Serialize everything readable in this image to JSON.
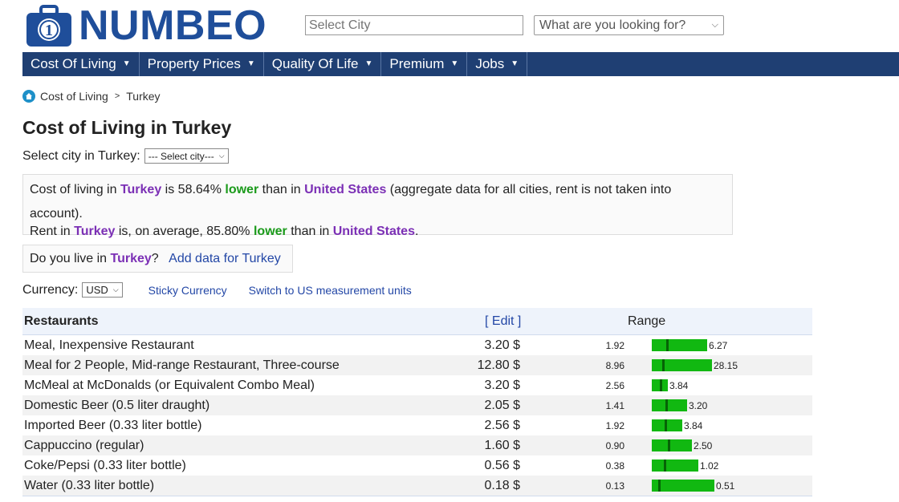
{
  "brand": {
    "name": "NUMBEO"
  },
  "search": {
    "city_placeholder": "Select City",
    "looking_for": "What are you looking for?"
  },
  "nav": [
    {
      "label": "Cost Of Living"
    },
    {
      "label": "Property Prices"
    },
    {
      "label": "Quality Of Life"
    },
    {
      "label": "Premium"
    },
    {
      "label": "Jobs"
    }
  ],
  "breadcrumb": {
    "first": "Cost of Living",
    "sep": ">",
    "second": "Turkey"
  },
  "page": {
    "title": "Cost of Living in Turkey"
  },
  "select_city": {
    "label": "Select city in Turkey:",
    "value": "--- Select city---"
  },
  "info": {
    "line1_a": "Cost of living in ",
    "line1_country": "Turkey",
    "line1_b": " is 58.64% ",
    "line1_lower": "lower",
    "line1_c": " than in ",
    "line1_us": "United States",
    "line1_d": " (aggregate data for all cities, rent is not taken into account).",
    "line2_a": "Rent in ",
    "line2_country": "Turkey",
    "line2_b": " is, on average, 85.80% ",
    "line2_lower": "lower",
    "line2_c": " than in ",
    "line2_us": "United States",
    "line2_d": "."
  },
  "live": {
    "q_a": "Do you live in ",
    "q_country": "Turkey",
    "q_b": "?",
    "add_link": "Add data for Turkey"
  },
  "currency": {
    "label": "Currency:",
    "value": "USD",
    "sticky": "Sticky Currency",
    "switch": "Switch to US measurement units"
  },
  "table": {
    "category": "Restaurants",
    "edit": "[ Edit ]",
    "range_header": "Range",
    "rows": [
      {
        "item": "Meal, Inexpensive Restaurant",
        "price": "3.20 $",
        "low": "1.92",
        "high": "6.27",
        "avg": 3.2
      },
      {
        "item": "Meal for 2 People, Mid-range Restaurant, Three-course",
        "price": "12.80 $",
        "low": "8.96",
        "high": "28.15",
        "avg": 12.8
      },
      {
        "item": "McMeal at McDonalds (or Equivalent Combo Meal)",
        "price": "3.20 $",
        "low": "2.56",
        "high": "3.84",
        "avg": 3.2
      },
      {
        "item": "Domestic Beer (0.5 liter draught)",
        "price": "2.05 $",
        "low": "1.41",
        "high": "3.20",
        "avg": 2.05
      },
      {
        "item": "Imported Beer (0.33 liter bottle)",
        "price": "2.56 $",
        "low": "1.92",
        "high": "3.84",
        "avg": 2.56
      },
      {
        "item": "Cappuccino (regular)",
        "price": "1.60 $",
        "low": "0.90",
        "high": "2.50",
        "avg": 1.6
      },
      {
        "item": "Coke/Pepsi (0.33 liter bottle)",
        "price": "0.56 $",
        "low": "0.38",
        "high": "1.02",
        "avg": 0.56
      },
      {
        "item": "Water (0.33 liter bottle)",
        "price": "0.18 $",
        "low": "0.13",
        "high": "0.51",
        "avg": 0.18
      }
    ]
  },
  "colors": {
    "brand_blue": "#1f4e9a",
    "nav_bg": "#1f3f73",
    "purple": "#7b2fb5",
    "green": "#1a9a1a",
    "bar_green": "#11b811",
    "link": "#2347a6"
  }
}
